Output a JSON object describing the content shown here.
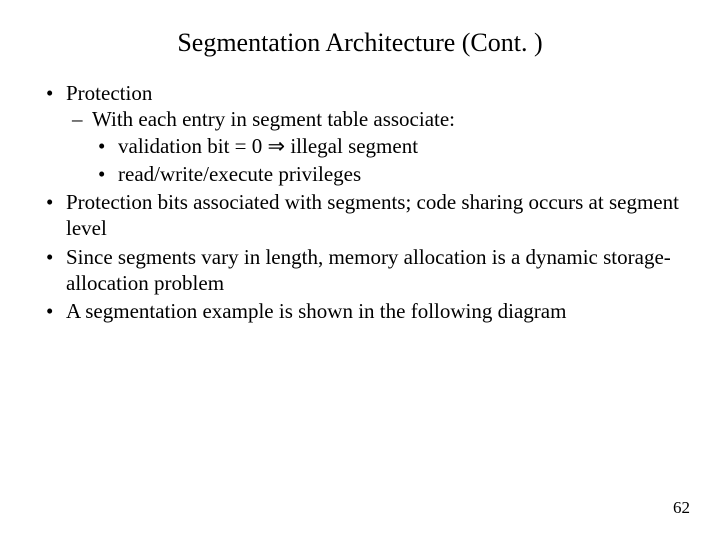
{
  "title": "Segmentation Architecture (Cont. )",
  "bullets": {
    "b0": "Protection",
    "b0_0": "With each entry in segment table associate:",
    "b0_0_0": "validation bit = 0 ⇒ illegal segment",
    "b0_0_1": "read/write/execute privileges",
    "b1": "Protection bits associated with segments; code sharing occurs at segment level",
    "b2": "Since segments vary in length, memory allocation is a dynamic storage-allocation problem",
    "b3": "A segmentation example is shown in the following diagram"
  },
  "page_number": "62"
}
